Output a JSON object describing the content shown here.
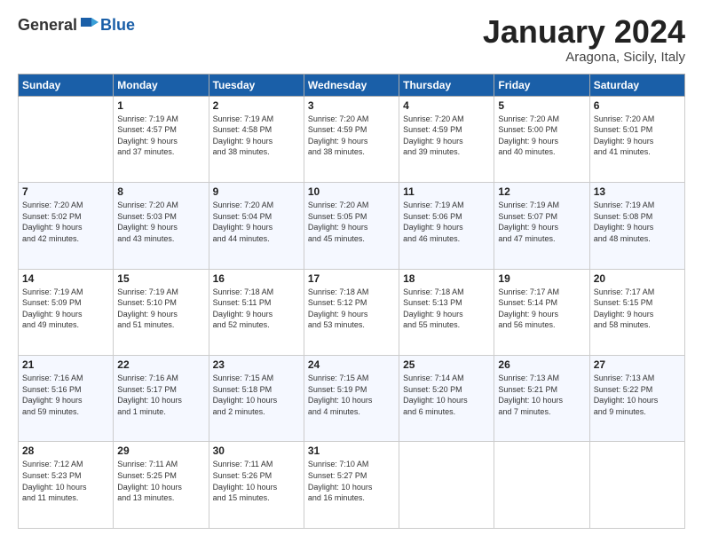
{
  "logo": {
    "text_general": "General",
    "text_blue": "Blue"
  },
  "header": {
    "month_title": "January 2024",
    "subtitle": "Aragona, Sicily, Italy"
  },
  "columns": [
    "Sunday",
    "Monday",
    "Tuesday",
    "Wednesday",
    "Thursday",
    "Friday",
    "Saturday"
  ],
  "weeks": [
    [
      {
        "day": "",
        "info": ""
      },
      {
        "day": "1",
        "info": "Sunrise: 7:19 AM\nSunset: 4:57 PM\nDaylight: 9 hours\nand 37 minutes."
      },
      {
        "day": "2",
        "info": "Sunrise: 7:19 AM\nSunset: 4:58 PM\nDaylight: 9 hours\nand 38 minutes."
      },
      {
        "day": "3",
        "info": "Sunrise: 7:20 AM\nSunset: 4:59 PM\nDaylight: 9 hours\nand 38 minutes."
      },
      {
        "day": "4",
        "info": "Sunrise: 7:20 AM\nSunset: 4:59 PM\nDaylight: 9 hours\nand 39 minutes."
      },
      {
        "day": "5",
        "info": "Sunrise: 7:20 AM\nSunset: 5:00 PM\nDaylight: 9 hours\nand 40 minutes."
      },
      {
        "day": "6",
        "info": "Sunrise: 7:20 AM\nSunset: 5:01 PM\nDaylight: 9 hours\nand 41 minutes."
      }
    ],
    [
      {
        "day": "7",
        "info": "Sunrise: 7:20 AM\nSunset: 5:02 PM\nDaylight: 9 hours\nand 42 minutes."
      },
      {
        "day": "8",
        "info": "Sunrise: 7:20 AM\nSunset: 5:03 PM\nDaylight: 9 hours\nand 43 minutes."
      },
      {
        "day": "9",
        "info": "Sunrise: 7:20 AM\nSunset: 5:04 PM\nDaylight: 9 hours\nand 44 minutes."
      },
      {
        "day": "10",
        "info": "Sunrise: 7:20 AM\nSunset: 5:05 PM\nDaylight: 9 hours\nand 45 minutes."
      },
      {
        "day": "11",
        "info": "Sunrise: 7:19 AM\nSunset: 5:06 PM\nDaylight: 9 hours\nand 46 minutes."
      },
      {
        "day": "12",
        "info": "Sunrise: 7:19 AM\nSunset: 5:07 PM\nDaylight: 9 hours\nand 47 minutes."
      },
      {
        "day": "13",
        "info": "Sunrise: 7:19 AM\nSunset: 5:08 PM\nDaylight: 9 hours\nand 48 minutes."
      }
    ],
    [
      {
        "day": "14",
        "info": "Sunrise: 7:19 AM\nSunset: 5:09 PM\nDaylight: 9 hours\nand 49 minutes."
      },
      {
        "day": "15",
        "info": "Sunrise: 7:19 AM\nSunset: 5:10 PM\nDaylight: 9 hours\nand 51 minutes."
      },
      {
        "day": "16",
        "info": "Sunrise: 7:18 AM\nSunset: 5:11 PM\nDaylight: 9 hours\nand 52 minutes."
      },
      {
        "day": "17",
        "info": "Sunrise: 7:18 AM\nSunset: 5:12 PM\nDaylight: 9 hours\nand 53 minutes."
      },
      {
        "day": "18",
        "info": "Sunrise: 7:18 AM\nSunset: 5:13 PM\nDaylight: 9 hours\nand 55 minutes."
      },
      {
        "day": "19",
        "info": "Sunrise: 7:17 AM\nSunset: 5:14 PM\nDaylight: 9 hours\nand 56 minutes."
      },
      {
        "day": "20",
        "info": "Sunrise: 7:17 AM\nSunset: 5:15 PM\nDaylight: 9 hours\nand 58 minutes."
      }
    ],
    [
      {
        "day": "21",
        "info": "Sunrise: 7:16 AM\nSunset: 5:16 PM\nDaylight: 9 hours\nand 59 minutes."
      },
      {
        "day": "22",
        "info": "Sunrise: 7:16 AM\nSunset: 5:17 PM\nDaylight: 10 hours\nand 1 minute."
      },
      {
        "day": "23",
        "info": "Sunrise: 7:15 AM\nSunset: 5:18 PM\nDaylight: 10 hours\nand 2 minutes."
      },
      {
        "day": "24",
        "info": "Sunrise: 7:15 AM\nSunset: 5:19 PM\nDaylight: 10 hours\nand 4 minutes."
      },
      {
        "day": "25",
        "info": "Sunrise: 7:14 AM\nSunset: 5:20 PM\nDaylight: 10 hours\nand 6 minutes."
      },
      {
        "day": "26",
        "info": "Sunrise: 7:13 AM\nSunset: 5:21 PM\nDaylight: 10 hours\nand 7 minutes."
      },
      {
        "day": "27",
        "info": "Sunrise: 7:13 AM\nSunset: 5:22 PM\nDaylight: 10 hours\nand 9 minutes."
      }
    ],
    [
      {
        "day": "28",
        "info": "Sunrise: 7:12 AM\nSunset: 5:23 PM\nDaylight: 10 hours\nand 11 minutes."
      },
      {
        "day": "29",
        "info": "Sunrise: 7:11 AM\nSunset: 5:25 PM\nDaylight: 10 hours\nand 13 minutes."
      },
      {
        "day": "30",
        "info": "Sunrise: 7:11 AM\nSunset: 5:26 PM\nDaylight: 10 hours\nand 15 minutes."
      },
      {
        "day": "31",
        "info": "Sunrise: 7:10 AM\nSunset: 5:27 PM\nDaylight: 10 hours\nand 16 minutes."
      },
      {
        "day": "",
        "info": ""
      },
      {
        "day": "",
        "info": ""
      },
      {
        "day": "",
        "info": ""
      }
    ]
  ]
}
